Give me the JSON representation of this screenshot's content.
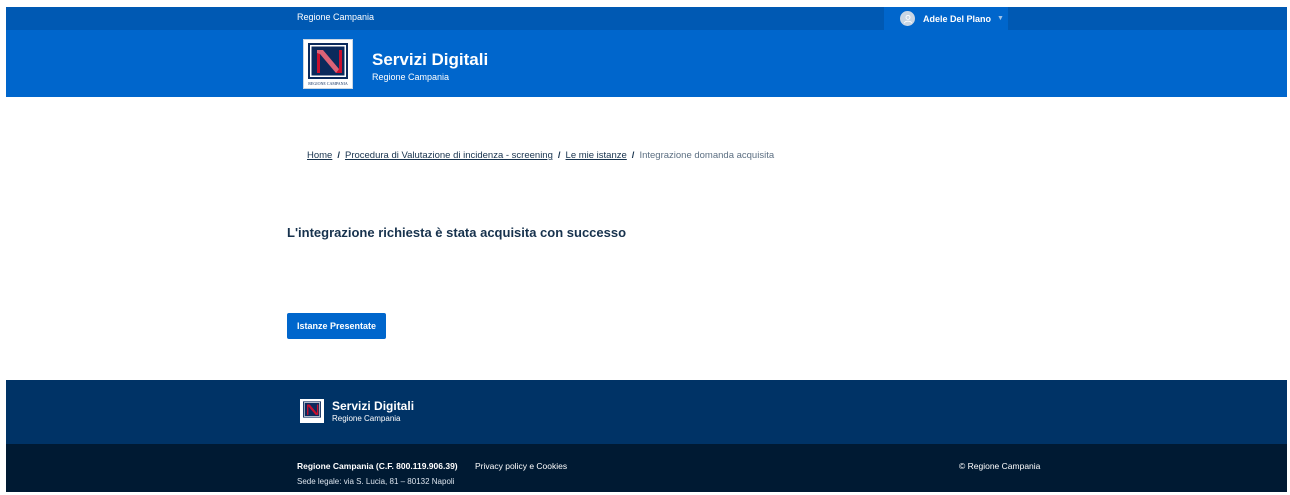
{
  "top_bar": {
    "region_link": "Regione Campania",
    "user_name": "Adele Del Plano"
  },
  "header": {
    "logo_text": "REGIONE CAMPANIA",
    "title": "Servizi Digitali",
    "subtitle": "Regione Campania"
  },
  "breadcrumb": {
    "items": [
      {
        "label": "Home"
      },
      {
        "label": "Procedura di Valutazione di incidenza - screening"
      },
      {
        "label": "Le mie istanze"
      }
    ],
    "separator": "/",
    "current": "Integrazione domanda acquisita"
  },
  "main": {
    "message": "L'integrazione richiesta è stata acquisita con successo",
    "button_label": "Istanze Presentate"
  },
  "footer": {
    "title": "Servizi Digitali",
    "subtitle": "Regione Campania",
    "org": "Regione Campania (C.F. 800.119.906.39)",
    "address": "Sede legale: via S. Lucia, 81 – 80132 Napoli",
    "privacy_link": "Privacy policy e Cookies",
    "copyright": "© Regione Campania"
  },
  "colors": {
    "primary": "#0066cc",
    "top_bar": "#0059b3",
    "footer_top": "#003366",
    "footer_bottom": "#001a33",
    "text_dark": "#17324d"
  },
  "icons": {
    "user_avatar": "user-avatar-icon",
    "user_menu_chevron": "chevron-down-icon",
    "logo": "regione-campania-logo"
  }
}
